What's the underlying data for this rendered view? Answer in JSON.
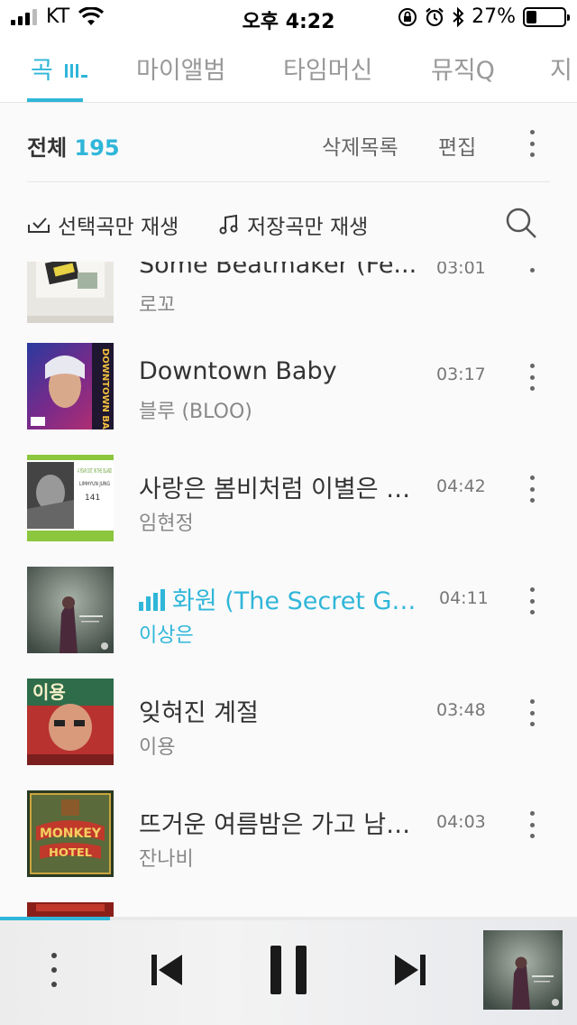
{
  "status_bar": {
    "carrier": "KT",
    "time": "오후 4:22",
    "battery_percent": "27%",
    "battery_level": 0.27
  },
  "tabs": [
    {
      "label": "곡",
      "active": true
    },
    {
      "label": "마이앨범",
      "active": false
    },
    {
      "label": "타임머신",
      "active": false
    },
    {
      "label": "뮤직Q",
      "active": false
    },
    {
      "label": "지",
      "active": false
    }
  ],
  "header": {
    "total_label": "전체",
    "total_count": "195",
    "deleted_label": "삭제목록",
    "edit_label": "편집"
  },
  "play_options": {
    "selected_only": "선택곡만 재생",
    "saved_only": "저장곡만 재생"
  },
  "songs": [
    {
      "title": "Some Beatmaker (Fe...",
      "artist": "로꼬",
      "duration": "03:01"
    },
    {
      "title": "Downtown Baby",
      "artist": "블루 (BLOO)",
      "duration": "03:17"
    },
    {
      "title": "사랑은 봄비처럼 이별은 겨울비처럼",
      "artist": "임현정",
      "duration": "04:42"
    },
    {
      "title": "화원 (The Secret Garden)",
      "artist": "이상은",
      "duration": "04:11",
      "playing": true
    },
    {
      "title": "잊혀진 계절",
      "artist": "이용",
      "duration": "03:48"
    },
    {
      "title": "뜨거운 여름밤은 가고 남은 건 볼품없지만",
      "artist": "잔나비",
      "duration": "04:03"
    }
  ],
  "album_text": {
    "downtown_baby": "DOWNTOWN BABY",
    "im_hyunjung": "A YEAR OUT, IN THE ISLAND",
    "im_hyunjung_name": "LIMHYUN JUNG",
    "leeyong": "이용",
    "monkey": "MONKEY",
    "hotel": "HOTEL"
  },
  "player": {
    "progress": 0.19
  },
  "colors": {
    "accent": "#2fb6d9",
    "text": "#333333",
    "subtext": "#888888",
    "background": "#fafafa"
  }
}
